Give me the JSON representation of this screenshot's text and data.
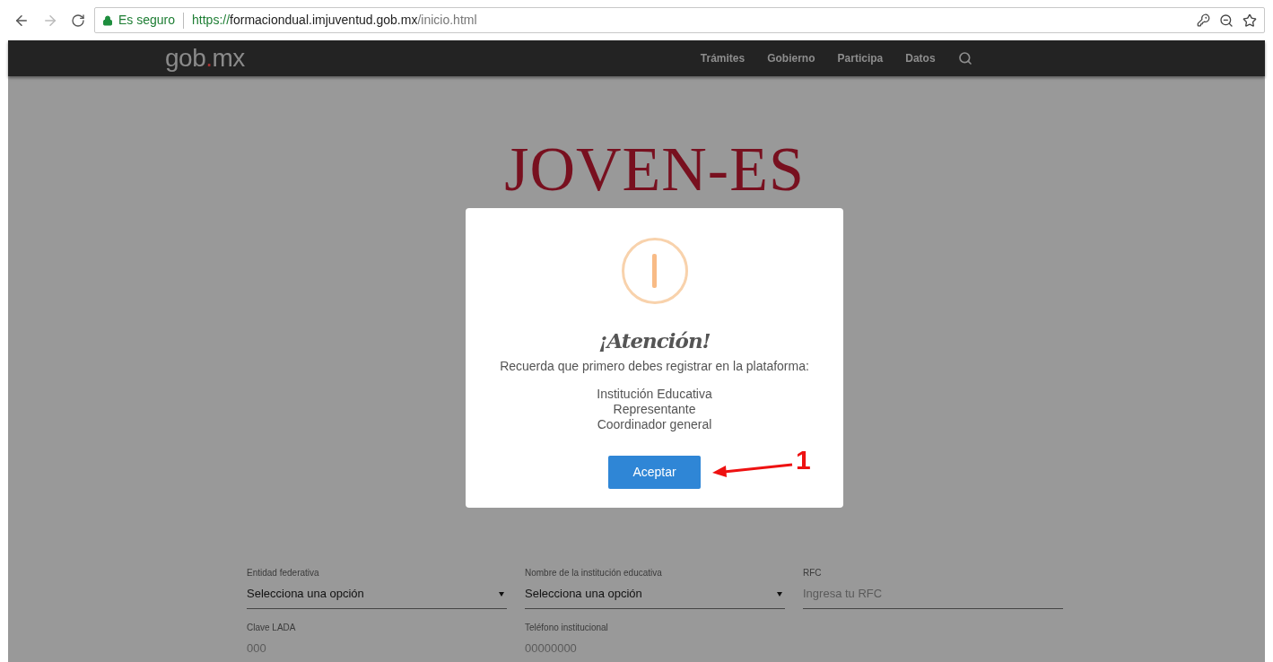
{
  "browser": {
    "secure_label": "Es seguro",
    "url_scheme": "https://",
    "url_host": "formaciondual.imjuventud.gob.mx",
    "url_path": "/inicio.html"
  },
  "navbar": {
    "logo": {
      "before": "gob",
      "dot": ".",
      "after": "mx"
    },
    "links": [
      "Trámites",
      "Gobierno",
      "Participa",
      "Datos"
    ]
  },
  "hero": {
    "title": "JOVEN-ES"
  },
  "form": {
    "fields": [
      {
        "kind": "select",
        "label": "Entidad federativa",
        "value": "Selecciona una opción"
      },
      {
        "kind": "select",
        "label": "Nombre de la institución educativa",
        "value": "Selecciona una opción"
      },
      {
        "kind": "text",
        "label": "RFC",
        "placeholder": "Ingresa tu RFC"
      },
      {
        "kind": "text",
        "label": "Clave LADA",
        "placeholder": "000"
      },
      {
        "kind": "text",
        "label": "Teléfono institucional",
        "placeholder": "00000000"
      }
    ]
  },
  "dialog": {
    "title": "¡Atención!",
    "message": "Recuerda que primero debes registrar en la plataforma:",
    "items": [
      "Institución Educativa",
      "Representante",
      "Coordinador general"
    ],
    "button": "Aceptar"
  },
  "annotation": {
    "label": "1"
  }
}
